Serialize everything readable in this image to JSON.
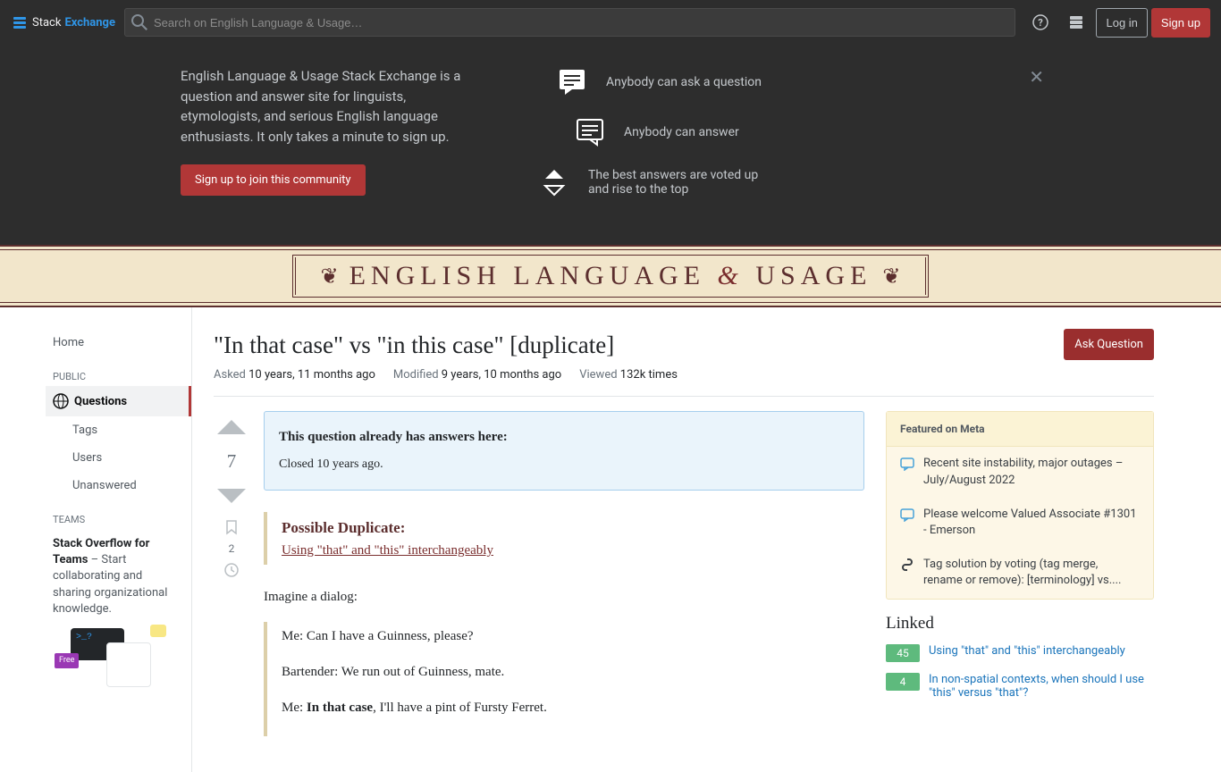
{
  "topbar": {
    "logo_stack": "Stack",
    "logo_exchange": "Exchange",
    "search_placeholder": "Search on English Language & Usage…",
    "login": "Log in",
    "signup": "Sign up"
  },
  "hero": {
    "description": "English Language & Usage Stack Exchange is a question and answer site for linguists, etymologists, and serious English language enthusiasts. It only takes a minute to sign up.",
    "join_button": "Sign up to join this community",
    "feature1": "Anybody can ask a question",
    "feature2": "Anybody can answer",
    "feature3": "The best answers are voted up and rise to the top"
  },
  "site_header": {
    "title": "ENGLISH LANGUAGE & USAGE"
  },
  "nav": {
    "home": "Home",
    "public": "PUBLIC",
    "questions": "Questions",
    "tags": "Tags",
    "users": "Users",
    "unanswered": "Unanswered",
    "teams": "TEAMS"
  },
  "teams": {
    "strong": "Stack Overflow for Teams",
    "text": " – Start collaborating and sharing organizational knowledge.",
    "free": "Free",
    "prompt": ">_?"
  },
  "question": {
    "title": "\"In that case\" vs \"in this case\" [duplicate]",
    "ask_button": "Ask Question",
    "asked_label": "Asked",
    "asked_value": "10 years, 11 months ago",
    "modified_label": "Modified",
    "modified_value": "9 years, 10 months ago",
    "viewed_label": "Viewed",
    "viewed_value": "132k times",
    "vote_count": "7",
    "bookmark_count": "2",
    "notice_heading": "This question already has answers here:",
    "notice_sub": "Closed 10 years ago.",
    "dup_heading": "Possible Duplicate:",
    "dup_link": "Using \"that\" and \"this\" interchangeably",
    "body_intro": "Imagine a dialog:",
    "quote1": "Me: Can I have a Guinness, please?",
    "quote2": "Bartender: We run out of Guinness, mate.",
    "quote3_pre": "Me: ",
    "quote3_bold": "In that case",
    "quote3_post": ", I'll have a pint of Fursty Ferret."
  },
  "meta": {
    "heading": "Featured on Meta",
    "item1": "Recent site instability, major outages – July/August 2022",
    "item2": "Please welcome Valued Associate #1301 - Emerson",
    "item3": "Tag solution by voting (tag merge, rename or remove): [terminology] vs...."
  },
  "linked": {
    "heading": "Linked",
    "items": [
      {
        "score": "45",
        "text": "Using \"that\" and \"this\" interchangeably"
      },
      {
        "score": "4",
        "text": "In non-spatial contexts, when should I use \"this\" versus \"that\"?"
      }
    ]
  }
}
